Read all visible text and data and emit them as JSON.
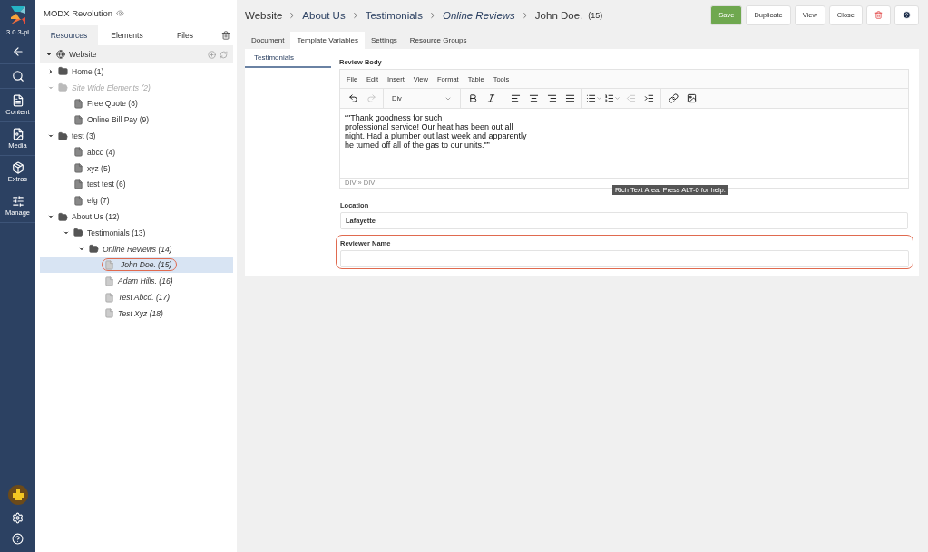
{
  "nav": {
    "version": "3.0.3-pl",
    "items": [
      {
        "kind": "back"
      },
      {
        "kind": "search"
      },
      {
        "kind": "content",
        "label": "Content"
      },
      {
        "kind": "media",
        "label": "Media"
      },
      {
        "kind": "extras",
        "label": "Extras"
      },
      {
        "kind": "manage",
        "label": "Manage"
      }
    ],
    "bottom": [
      {
        "kind": "user"
      },
      {
        "kind": "settings"
      },
      {
        "kind": "help"
      }
    ]
  },
  "tree_panel": {
    "title": "MODX Revolution",
    "tabs": [
      {
        "label": "Resources",
        "selected": true
      },
      {
        "label": "Elements",
        "selected": false
      },
      {
        "label": "Files",
        "selected": false
      }
    ],
    "root": {
      "label": "Website",
      "expanded": true
    },
    "items": [
      {
        "kind": "folder",
        "label": "Home (1)",
        "expanded": false,
        "italic": false,
        "disabled": false,
        "selected": false,
        "highlighted": false
      },
      {
        "kind": "folder",
        "label": "Site Wide Elements (2)",
        "expanded": true,
        "italic": true,
        "disabled": true,
        "selected": false,
        "highlighted": false,
        "children": [
          {
            "kind": "document",
            "label": "Free Quote (8)",
            "italic": false,
            "disabled": false,
            "selected": false,
            "highlighted": false
          },
          {
            "kind": "document",
            "label": "Online Bill Pay (9)",
            "italic": false,
            "disabled": false,
            "selected": false,
            "highlighted": false
          }
        ]
      },
      {
        "kind": "folder",
        "label": "test (3)",
        "expanded": true,
        "italic": false,
        "disabled": false,
        "selected": false,
        "highlighted": false,
        "children": [
          {
            "kind": "document",
            "label": "abcd (4)",
            "italic": false,
            "disabled": false,
            "selected": false,
            "highlighted": false
          },
          {
            "kind": "document",
            "label": "xyz (5)",
            "italic": false,
            "disabled": false,
            "selected": false,
            "highlighted": false
          },
          {
            "kind": "document",
            "label": "test test (6)",
            "italic": false,
            "disabled": false,
            "selected": false,
            "highlighted": false
          },
          {
            "kind": "document",
            "label": "efg (7)",
            "italic": false,
            "disabled": false,
            "selected": false,
            "highlighted": false
          }
        ]
      },
      {
        "kind": "folder",
        "label": "About Us (12)",
        "expanded": true,
        "italic": false,
        "disabled": false,
        "selected": false,
        "highlighted": false,
        "children": [
          {
            "kind": "folder",
            "label": "Testimonials (13)",
            "expanded": true,
            "italic": false,
            "disabled": false,
            "selected": false,
            "highlighted": false,
            "children": [
              {
                "kind": "folder",
                "label": "Online Reviews (14)",
                "expanded": true,
                "italic": true,
                "disabled": false,
                "selected": false,
                "highlighted": false,
                "children": [
                  {
                    "kind": "document",
                    "label": "John Doe. (15)",
                    "italic": true,
                    "disabled": false,
                    "selected": true,
                    "highlighted": true
                  },
                  {
                    "kind": "document",
                    "label": "Adam Hills. (16)",
                    "italic": true,
                    "disabled": false,
                    "selected": false,
                    "highlighted": false
                  },
                  {
                    "kind": "document",
                    "label": "Test Abcd. (17)",
                    "italic": true,
                    "disabled": false,
                    "selected": false,
                    "highlighted": false
                  },
                  {
                    "kind": "document",
                    "label": "Test Xyz (18)",
                    "italic": true,
                    "disabled": false,
                    "selected": false,
                    "highlighted": false
                  }
                ]
              }
            ]
          }
        ]
      }
    ]
  },
  "breadcrumbs": [
    {
      "kind": "plain",
      "label": "Website"
    },
    {
      "kind": "link",
      "label": "About Us"
    },
    {
      "kind": "link",
      "label": "Testimonials"
    },
    {
      "kind": "italic-link",
      "label": "Online Reviews"
    },
    {
      "kind": "current",
      "label": "John Doe.",
      "id_label": "(15)"
    }
  ],
  "actions": [
    {
      "kind": "primary",
      "label": "Save"
    },
    {
      "kind": "default",
      "label": "Duplicate"
    },
    {
      "kind": "default",
      "label": "View"
    },
    {
      "kind": "default",
      "label": "Close"
    },
    {
      "kind": "delete"
    },
    {
      "kind": "help"
    }
  ],
  "tabs": [
    {
      "label": "Document",
      "selected": false
    },
    {
      "label": "Template Variables",
      "selected": true
    },
    {
      "label": "Settings",
      "selected": false
    },
    {
      "label": "Resource Groups",
      "selected": false
    }
  ],
  "tv_tabs": [
    {
      "label": "Testimonials",
      "selected": true
    }
  ],
  "editor": {
    "label": "Review Body",
    "menu": [
      "File",
      "Edit",
      "Insert",
      "View",
      "Format",
      "Table",
      "Tools"
    ],
    "toolbar": [
      {
        "kind": "undo",
        "disabled": false
      },
      {
        "kind": "redo",
        "disabled": true
      },
      {
        "kind": "format",
        "label": "Div"
      },
      {
        "kind": "bold",
        "disabled": false
      },
      {
        "kind": "italic",
        "disabled": false
      },
      {
        "kind": "align-left",
        "disabled": false
      },
      {
        "kind": "align-center",
        "disabled": false
      },
      {
        "kind": "align-right",
        "disabled": false
      },
      {
        "kind": "justify",
        "disabled": false
      },
      {
        "kind": "bullet-list",
        "disabled": false
      },
      {
        "kind": "numbered-list",
        "disabled": false
      },
      {
        "kind": "outdent",
        "disabled": true
      },
      {
        "kind": "indent",
        "disabled": false
      },
      {
        "kind": "link",
        "disabled": false
      },
      {
        "kind": "image",
        "disabled": false
      }
    ],
    "content": "“\"Thank goodness for such\nprofessional service! Our heat has been out all\nnight. Had a plumber out last week and apparently\nhe turned off all of the gas to our units.\"”",
    "path": "DIV » DIV",
    "tooltip": "Rich Text Area. Press ALT-0 for help."
  },
  "fields": [
    {
      "label": "Location",
      "value": "Lafayette",
      "highlighted": false
    },
    {
      "label": "Reviewer Name",
      "highlighted": true
    }
  ]
}
